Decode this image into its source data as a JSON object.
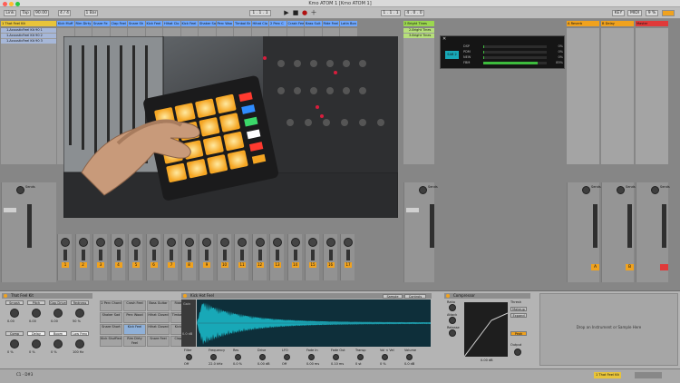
{
  "window": {
    "title": "Kmo ATOM 1  [Kmo ATOM 1]"
  },
  "transport": {
    "link": "Link",
    "tap": "Tap",
    "tempo": "90.00",
    "time_sig": "4 / 4",
    "metronome": "1 Bar",
    "position": "1 . 1 . 1",
    "loop_start": "1 . 1 . 1",
    "loop_end": "4 . 0 . 0",
    "key": "KEY",
    "midi": "MIDI",
    "cpu": "9 %"
  },
  "tracks": [
    {
      "name": "1 That Feel Kit",
      "color": "#e8c43a"
    },
    {
      "name": "Kick Muff",
      "color": "#6fa8ff"
    },
    {
      "name": "Rim Dirty",
      "color": "#6fa8ff"
    },
    {
      "name": "Snare Fe",
      "color": "#6fa8ff"
    },
    {
      "name": "Clap Feel",
      "color": "#6fa8ff"
    },
    {
      "name": "Snare Sh",
      "color": "#6fa8ff"
    },
    {
      "name": "Kick Feel",
      "color": "#6fa8ff"
    },
    {
      "name": "Hihat Clo",
      "color": "#6fa8ff"
    },
    {
      "name": "Kick Feel",
      "color": "#6fa8ff"
    },
    {
      "name": "Shaker Sa",
      "color": "#6fa8ff"
    },
    {
      "name": "Perc Woo",
      "color": "#6fa8ff"
    },
    {
      "name": "Timbal Br",
      "color": "#6fa8ff"
    },
    {
      "name": "Hihat Clo",
      "color": "#6fa8ff"
    },
    {
      "name": "2 Perc C",
      "color": "#6fa8ff"
    },
    {
      "name": "Crash Feel",
      "color": "#6fa8ff"
    },
    {
      "name": "Bass Suit",
      "color": "#6fa8ff"
    },
    {
      "name": "Ride Feel",
      "color": "#6fa8ff"
    },
    {
      "name": "Latin Bon",
      "color": "#6fa8ff"
    },
    {
      "name": "2 Bright Tines",
      "color": "#9bd84f"
    }
  ],
  "clips": {
    "drum": [
      "1-AcousticFeel Kit 90 1",
      "1-AcousticFeel Kit 90 2",
      "1-AcousticFeel Kit 90 3"
    ],
    "keys": [
      "2-Bright Tines",
      "3-Bright Tines"
    ]
  },
  "returns": [
    {
      "name": "A Reverb",
      "color": "#f0a21e",
      "letter": "A"
    },
    {
      "name": "B Delay",
      "color": "#f0a21e",
      "letter": "B"
    },
    {
      "name": "Master",
      "color": "#e03a3a",
      "letter": ""
    }
  ],
  "sends_label": "Sends",
  "plugin_window": {
    "icon": "SAB 2",
    "rows": [
      {
        "label": "DSP",
        "value": "0%",
        "level": 0.02
      },
      {
        "label": "PDM",
        "value": "0%",
        "level": 0.02
      },
      {
        "label": "NEW",
        "value": "0%",
        "level": 0.02
      },
      {
        "label": "FBM",
        "value": "85%",
        "level": 0.85
      }
    ]
  },
  "drum_rack": {
    "title": "That Feel Kit",
    "macros": [
      "Smash",
      "Pitch",
      "Gap Drive",
      "Redness",
      "Comp",
      "Delay",
      "Boom",
      "Low Freq"
    ],
    "macro_values": [
      "0.00",
      "0.00",
      "0.00",
      "50 %",
      "0 %",
      "0 %",
      "0 %",
      "100 Hz"
    ],
    "pads": [
      [
        "2 Perc Chord",
        "Crash Feel",
        "Bass Guitar",
        "Ride Feel"
      ],
      [
        "Shaker Sad",
        "Perc Wood",
        "Hihat Closed",
        "Timbal Song"
      ],
      [
        "Snare Short",
        "Kick Feel",
        "Hihat Closed",
        "Kick Feel"
      ],
      [
        "Kick Shuffled",
        "Rim Dirty Feel",
        "Snare Feel",
        "Clap Feel"
      ]
    ]
  },
  "sampler": {
    "title": "Kick Hot Feel",
    "tabs": [
      "Sample",
      "Controls"
    ],
    "params": [
      "Filter",
      "Frequency",
      "Res",
      "Drive",
      "LFO",
      "Fade In",
      "Fade Out",
      "Transp",
      "Vol < Vel",
      "Volume"
    ],
    "param_values": [
      "Off",
      "22.0 kHz",
      "0.0 %",
      "0.00 dB",
      "Off",
      "0.00 ms",
      "0.10 ms",
      "0 st",
      "0 %",
      "0.0 dB"
    ],
    "labels": [
      "Gain",
      "0.0 dB",
      "Start",
      "End",
      "Loop",
      "Snap"
    ]
  },
  "compressor": {
    "title": "Compressor",
    "params": [
      "Ratio",
      "Attack",
      "Release",
      "Thresh",
      "Output"
    ],
    "values": [
      "4.00 : 1",
      "2.00 ms",
      "50.0 ms",
      "0.00 dB",
      "0.00 dB"
    ],
    "mode": "Peak",
    "options": [
      "Makeup",
      "Expand"
    ]
  },
  "empty_slot": "Drop an Instrument or Sample Here",
  "status": {
    "position": "C1 - D#3",
    "track_label": "1 That Feel Kit"
  },
  "colors": {
    "accent": "#f0a21e",
    "track_blue": "#6fa8ff",
    "green": "#9bd84f",
    "master": "#e03a3a",
    "waveform": "#18a8b7"
  }
}
